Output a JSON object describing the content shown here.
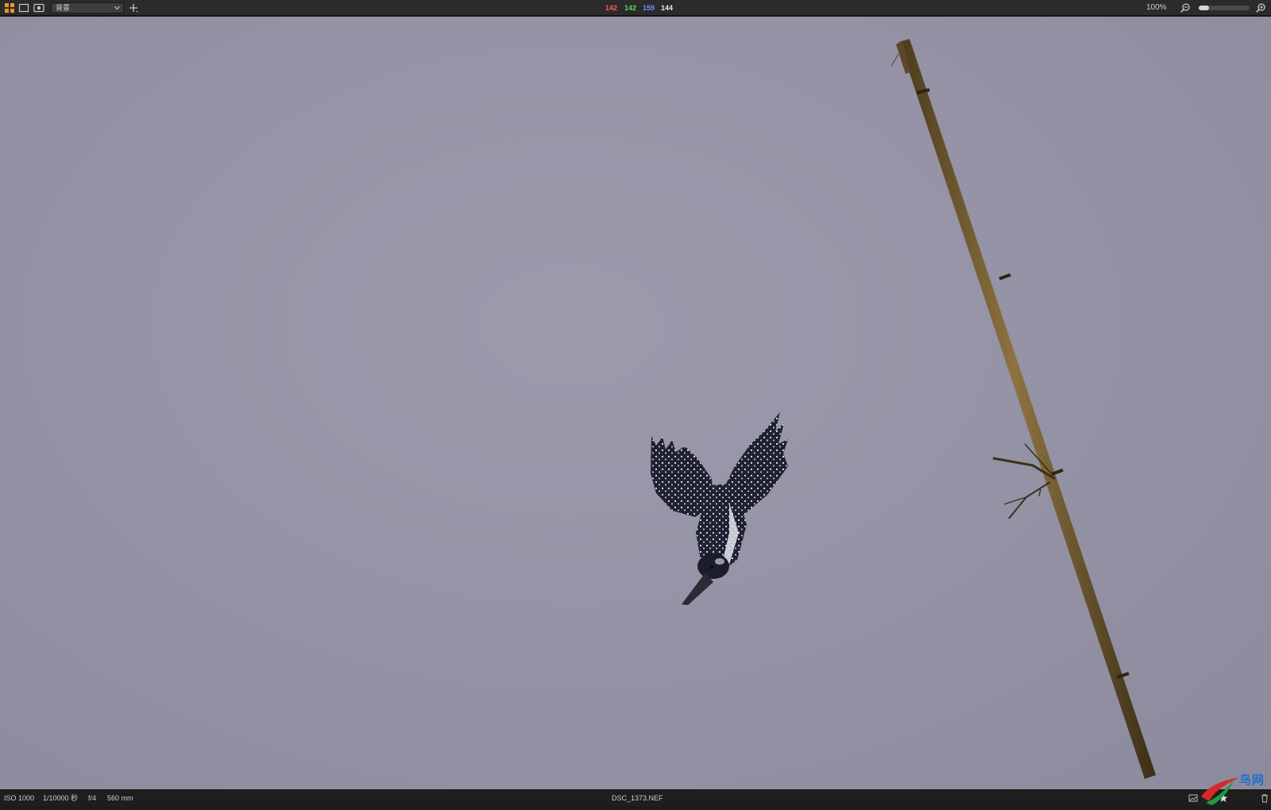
{
  "toolbar": {
    "layer_select": {
      "value": "背景"
    },
    "pixel_readout": {
      "r": "142",
      "g": "142",
      "b": "159",
      "luminance": "144"
    },
    "zoom": {
      "label": "100%",
      "level_fraction": 0.2
    },
    "icons": [
      "browser-grid-icon",
      "single-view-icon",
      "preview-eye-icon",
      "add-layer-icon",
      "zoom-out-icon",
      "zoom-in-icon"
    ]
  },
  "photo": {
    "subject": "kingfisher diving beside bamboo pole",
    "background_color": "#9593a5"
  },
  "status": {
    "iso": "ISO 1000",
    "shutter": "1/10000 秒",
    "aperture": "f/4",
    "focal_length": "560 mm",
    "filename": "DSC_1373.NEF"
  },
  "colors": {
    "red": "#ff5a5a",
    "green": "#60d060",
    "blue": "#7f8cff",
    "white": "#e6e6e6",
    "accent_orange": "#e8952a"
  },
  "watermark": {
    "text": "鸟网"
  }
}
